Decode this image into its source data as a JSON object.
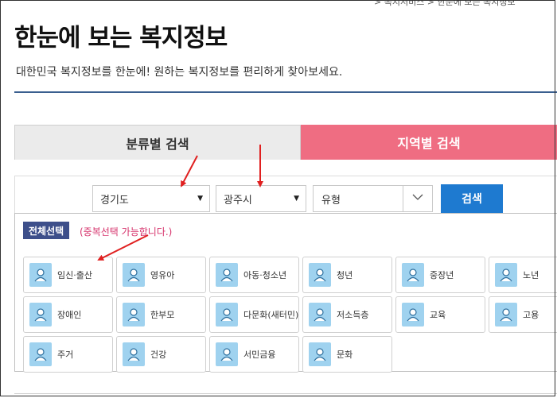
{
  "breadcrumb": "> 복지서비스 > 한눈에 보는 복지정보",
  "page": {
    "title": "한눈에 보는 복지정보",
    "subtitle": "대한민국 복지정보를 한눈에! 원하는 복지정보를 편리하게 찾아보세요."
  },
  "tabs": {
    "category": "분류별 검색",
    "region": "지역별 검색"
  },
  "search": {
    "province": "경기도",
    "city": "광주시",
    "type": "유형",
    "button": "검색"
  },
  "filter": {
    "select_all": "전체선택",
    "multi_note": "(중복선택 가능합니다.)"
  },
  "categories": [
    {
      "label": "임신·출산",
      "icon": "pregnancy-icon"
    },
    {
      "label": "영유아",
      "icon": "infant-icon"
    },
    {
      "label": "아동·청소년",
      "icon": "child-youth-icon"
    },
    {
      "label": "청년",
      "icon": "young-adult-icon"
    },
    {
      "label": "중장년",
      "icon": "middle-aged-icon"
    },
    {
      "label": "노년",
      "icon": "elderly-icon"
    },
    {
      "label": "장애인",
      "icon": "wheelchair-icon"
    },
    {
      "label": "한부모",
      "icon": "single-parent-icon"
    },
    {
      "label": "다문화(새터민)",
      "icon": "globe-icon"
    },
    {
      "label": "저소득층",
      "icon": "hand-heart-icon"
    },
    {
      "label": "교육",
      "icon": "book-icon"
    },
    {
      "label": "고용",
      "icon": "handshake-icon"
    },
    {
      "label": "주거",
      "icon": "house-icon"
    },
    {
      "label": "건강",
      "icon": "heart-pulse-icon"
    },
    {
      "label": "서민금융",
      "icon": "piggy-bank-icon"
    },
    {
      "label": "문화",
      "icon": "ferris-wheel-icon"
    }
  ],
  "colors": {
    "region_tab": "#ef6d82",
    "search_button": "#1e7ad0",
    "select_all": "#3d4f8a",
    "note": "#d6336c",
    "annotation_arrow": "#e02020",
    "icon_bg": "#9fd2ef"
  }
}
